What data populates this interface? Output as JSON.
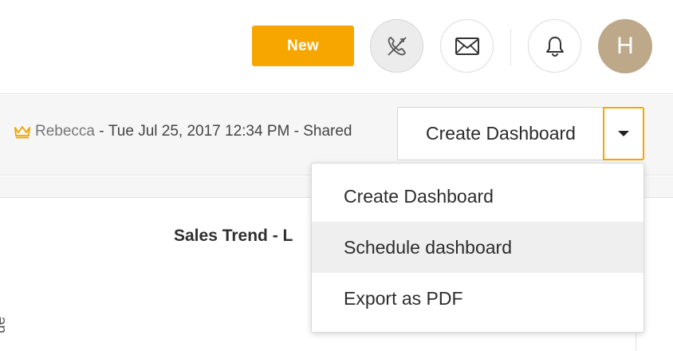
{
  "header": {
    "new_label": "New",
    "avatar_initial": "H",
    "icons": [
      "phone-disabled-icon",
      "mail-icon",
      "bell-icon"
    ]
  },
  "dashboard_meta": {
    "author": "Rebecca",
    "separator1": " - ",
    "date": "Tue Jul 25, 2017 12:34 PM",
    "separator2": " - ",
    "status": "Shared"
  },
  "actions": {
    "primary_label": "Create Dashboard",
    "menu_items": [
      {
        "label": "Create Dashboard"
      },
      {
        "label": "Schedule dashboard"
      },
      {
        "label": "Export as PDF"
      }
    ]
  },
  "chart": {
    "title_visible": "Sales Trend - L",
    "ylabel_visible": "ue"
  },
  "colors": {
    "accent": "#f7a600",
    "avatar_bg": "#bda98a",
    "menu_hover": "#efefef",
    "toolbar_bg": "#f6f6f6"
  }
}
